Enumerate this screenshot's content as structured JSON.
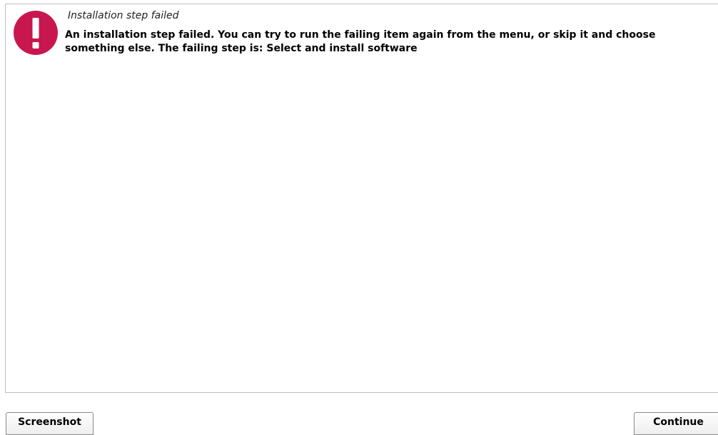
{
  "dialog": {
    "title": "Installation step failed",
    "message": "An installation step failed. You can try to run the failing item again from the menu, or skip it and choose something else. The failing step is: Select and install software",
    "icon": "alert-icon",
    "icon_color": "#c2185b"
  },
  "buttons": {
    "screenshot_label": "Screenshot",
    "continue_label": "Continue"
  }
}
